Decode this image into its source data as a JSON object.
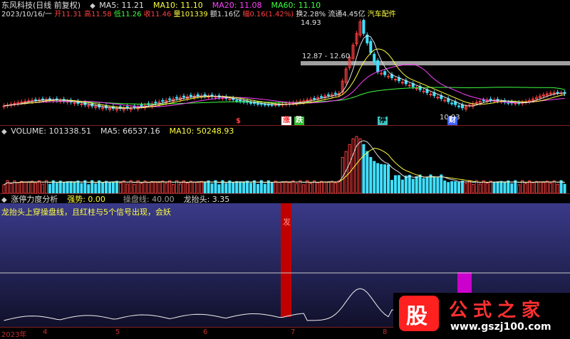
{
  "header": {
    "title": "东风科技(日线 前复权)",
    "ma5": "MA5: 11.21",
    "ma10": "MA10: 11.10",
    "ma20": "MA20: 11.08",
    "ma60": "MA60: 11.10",
    "date": "2023/10/16/一",
    "open": "开11.31",
    "high": "高11.58",
    "low": "低11.26",
    "close": "收11.46",
    "volume": "量101339",
    "amount": "额1.16亿",
    "change": "幅0.16(1.42%)",
    "turnover": "换2.28%",
    "float": "流通4.45亿",
    "sector": "汽车配件"
  },
  "price_annotations": {
    "peak": "14.93",
    "range": "12.87 - 12.60",
    "low": "10.93",
    "tag_zhang": "涨",
    "tag_die": "跌",
    "tag_ting": "停",
    "tag_cai": "财",
    "tag_s": "$"
  },
  "volume_header": {
    "volume": "VOLUME: 101338.51",
    "ma5": "MA5: 66537.16",
    "ma10": "MA10: 50248.93"
  },
  "indicator_header": {
    "name": "涨停力度分析",
    "strength": "强势: 0.00",
    "line": "操盘线: 40.00",
    "dragon": "龙抬头: 3.35"
  },
  "indicator_note": "龙抬头上穿操盘线，且红柱与5个信号出现，会妖",
  "indicator_signal": "发",
  "xaxis": {
    "year": "2023年",
    "months": [
      "4",
      "5",
      "6",
      "7",
      "8"
    ]
  },
  "watermark": {
    "stock": "股",
    "title": "公式之家",
    "url": "www.gszj100.com"
  },
  "colors": {
    "ma5": "#e0e0e0",
    "ma10": "#ffff40",
    "ma20": "#ff40ff",
    "ma60": "#40ff40",
    "up": "#ff4040",
    "down": "#40e0ff"
  }
}
